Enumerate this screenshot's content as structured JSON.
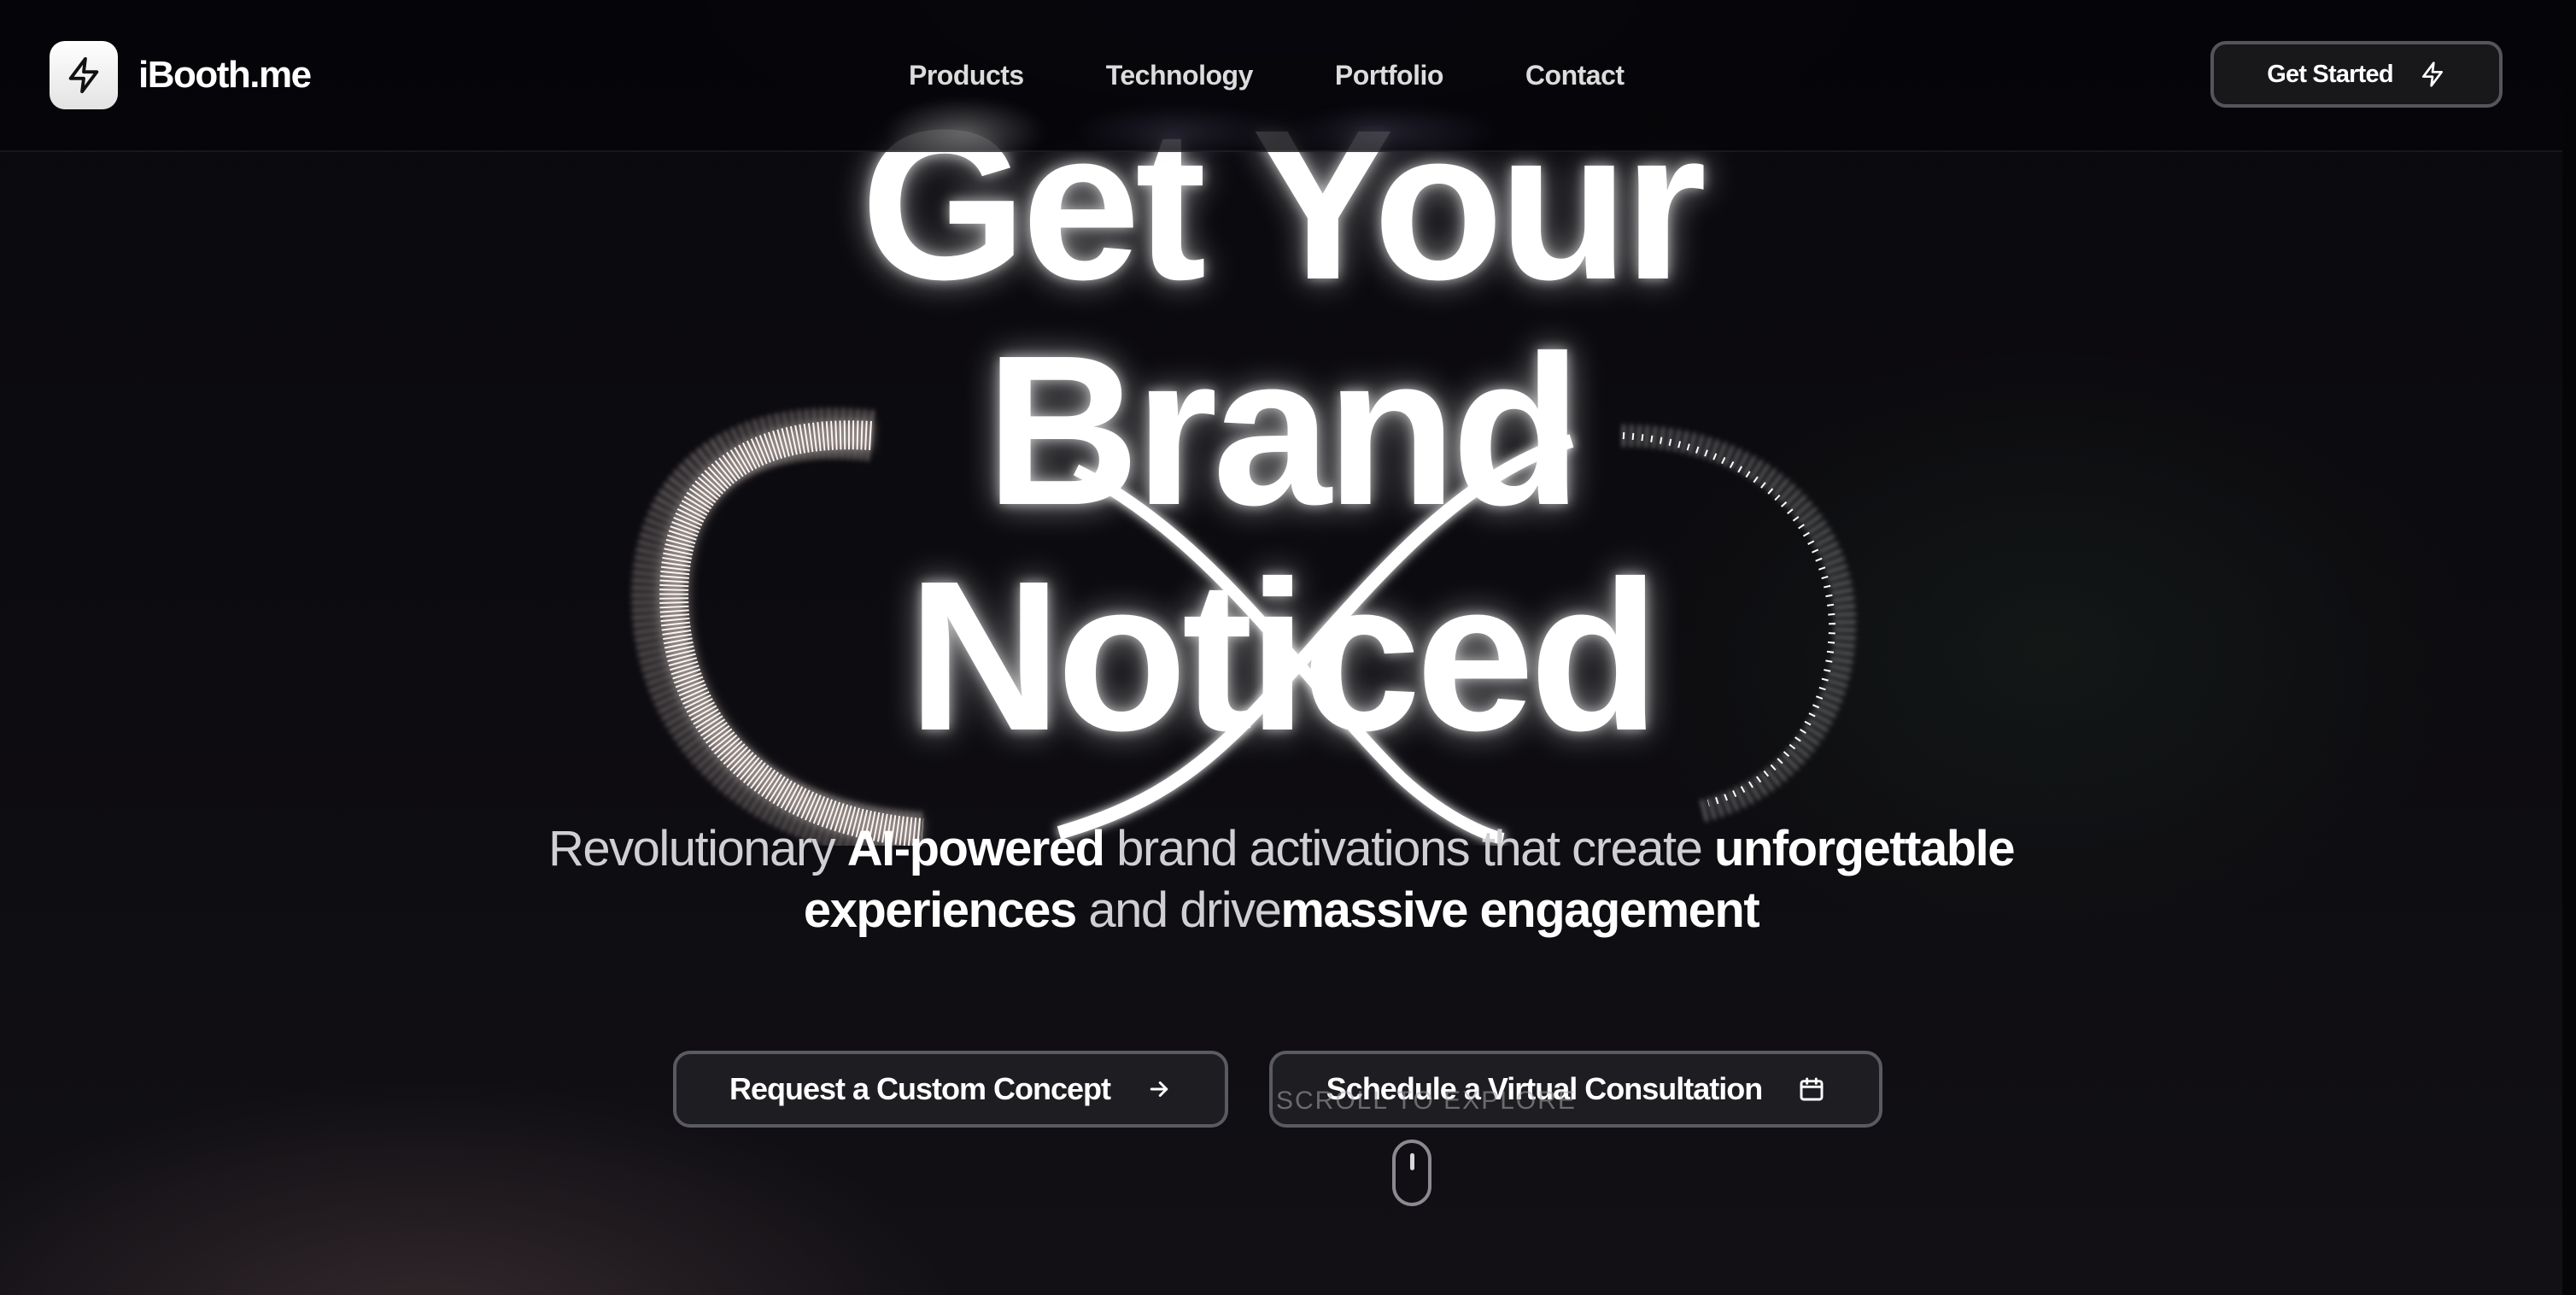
{
  "header": {
    "logo_text": "iBooth.me",
    "logo_icon": "lightning-bolt-icon",
    "nav": [
      {
        "label": "Products"
      },
      {
        "label": "Technology"
      },
      {
        "label": "Portfolio"
      },
      {
        "label": "Contact"
      }
    ],
    "cta_label": "Get Started",
    "cta_icon": "lightning-bolt-icon"
  },
  "hero": {
    "headline_lines": [
      "Get Your",
      "Brand",
      "Noticed"
    ],
    "subtitle": {
      "part1": "Revolutionary ",
      "part2": "AI-powered",
      "part3": " brand activations that create ",
      "part4": "unforgettable experiences",
      "part5": " and drive",
      "part6": "massive engagement"
    },
    "primary_button": {
      "label": "Request a Custom Concept",
      "icon": "arrow-right-icon"
    },
    "secondary_button": {
      "label": "Schedule a Virtual Consultation",
      "icon": "calendar-icon"
    },
    "scroll_hint": "SCROLL TO EXPLORE"
  },
  "colors": {
    "background": "#0b0a0d",
    "text": "#ffffff",
    "button_bg": "#1e1e22",
    "button_border": "#5a5a62"
  }
}
